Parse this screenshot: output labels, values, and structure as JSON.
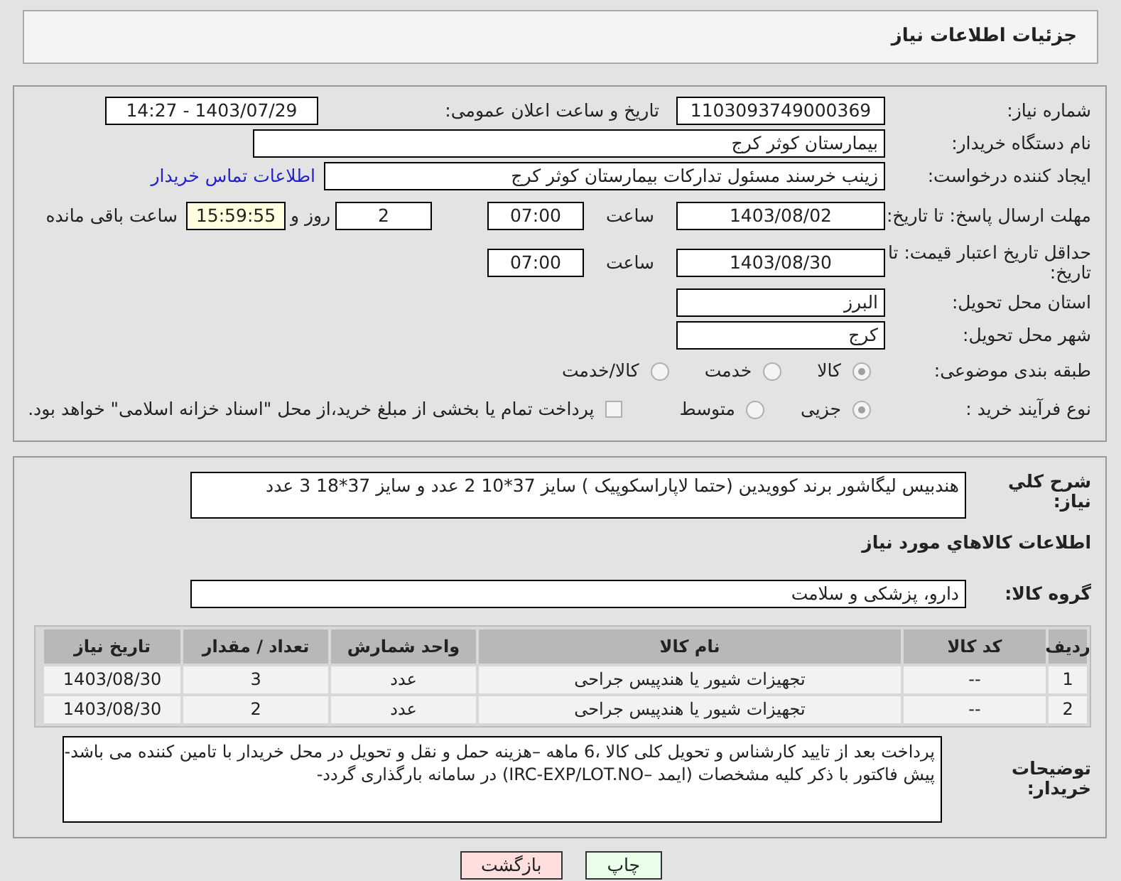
{
  "title": "جزئیات اطلاعات نیاز",
  "need_number": {
    "label": "شماره نیاز:",
    "value": "1103093749000369"
  },
  "announce": {
    "label": "تاریخ و ساعت اعلان عمومی:",
    "value": "1403/07/29 - 14:27"
  },
  "buyer_org": {
    "label": "نام دستگاه خریدار:",
    "value": "بیمارستان کوثر کرج"
  },
  "requester": {
    "label": "ایجاد کننده درخواست:",
    "value": "زینب خرسند مسئول تدارکات بیمارستان کوثر کرج",
    "link": "اطلاعات تماس خریدار"
  },
  "deadline": {
    "label": "مهلت ارسال پاسخ: تا تاریخ:",
    "date": "1403/08/02",
    "time_label": "ساعت",
    "time": "07:00",
    "days": "2",
    "days_label": "روز و",
    "remaining": "15:59:55",
    "remaining_label": "ساعت باقی مانده"
  },
  "validity": {
    "label": "حداقل تاریخ اعتبار قیمت: تا تاریخ:",
    "date": "1403/08/30",
    "time_label": "ساعت",
    "time": "07:00"
  },
  "province": {
    "label": "استان محل تحویل:",
    "value": "البرز"
  },
  "city": {
    "label": "شهر محل تحویل:",
    "value": "کرج"
  },
  "category": {
    "label": "طبقه بندی موضوعی:",
    "options": [
      {
        "label": "کالا",
        "selected": true
      },
      {
        "label": "خدمت",
        "selected": false
      },
      {
        "label": "کالا/خدمت",
        "selected": false
      }
    ]
  },
  "process": {
    "label": "نوع فرآیند خرید :",
    "options": [
      {
        "label": "جزیی",
        "selected": true
      },
      {
        "label": "متوسط",
        "selected": false
      }
    ],
    "payment": {
      "label": "پرداخت تمام یا بخشی از مبلغ خرید،از محل \"اسناد خزانه اسلامی\" خواهد بود.",
      "checked": false
    }
  },
  "description": {
    "label": "شرح کلي نياز:",
    "value": "هندبیس لیگاشور برند کوویدین (حتما لاپاراسکوپیک ) سایز 37*10 2 عدد و سایز 37*18 3 عدد"
  },
  "goods_heading": "اطلاعات کالاهاي مورد نياز",
  "goods_group": {
    "label": "گروه کالا:",
    "value": "دارو، پزشکی و سلامت"
  },
  "table": {
    "columns": [
      "ردیف",
      "کد کالا",
      "نام کالا",
      "واحد شمارش",
      "تعداد / مقدار",
      "تاریخ نیاز"
    ],
    "rows": [
      [
        "1",
        "--",
        "تجهیزات شیور یا هندپیس جراحی",
        "عدد",
        "3",
        "1403/08/30"
      ],
      [
        "2",
        "--",
        "تجهیزات شیور یا هندپیس جراحی",
        "عدد",
        "2",
        "1403/08/30"
      ]
    ]
  },
  "buyer_notes": {
    "label": "توضیحات خریدار:",
    "lines": [
      "پرداخت بعد از تایید کارشناس و تحویل کلی کالا ،6 ماهه –هزینه حمل و نقل و تحویل در محل خریدار با تامین کننده می باشد-",
      "پیش فاکتور با ذکر کلیه مشخصات (ایمد –IRC-EXP/LOT.NO) در سامانه بارگذاری گردد-"
    ]
  },
  "buttons": [
    {
      "label": "چاپ",
      "kind": "print"
    },
    {
      "label": "بازگشت",
      "kind": "back"
    }
  ]
}
